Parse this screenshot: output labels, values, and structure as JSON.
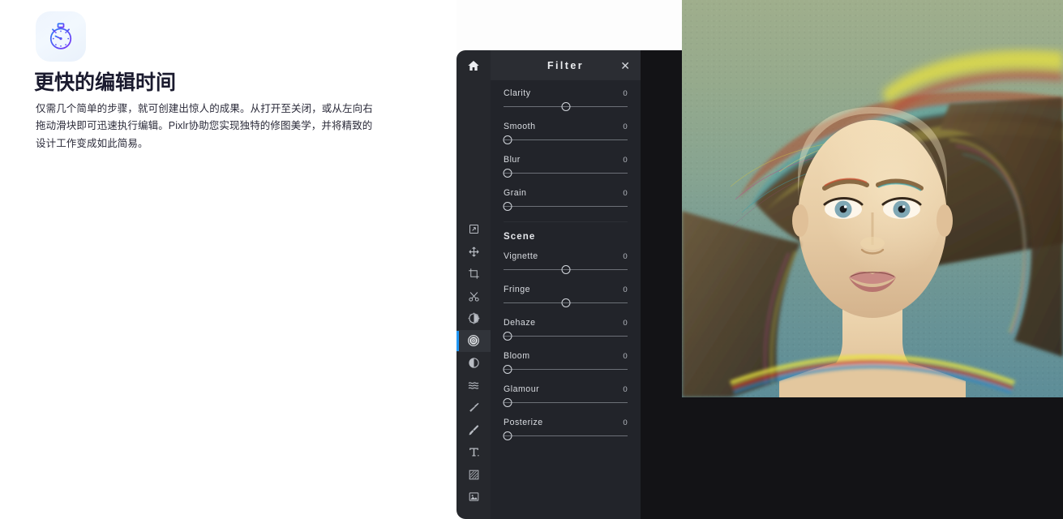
{
  "promo": {
    "icon_name": "stopwatch-icon",
    "title": "更快的编辑时间",
    "body": "仅需几个简单的步骤，就可创建出惊人的成果。从打开至关闭，或从左向右拖动滑块即可迅速执行编辑。Pixlr协助您实现独特的修图美学，并将精致的设计工作变成如此简易。",
    "icon_gradient_from": "#2f7df6",
    "icon_gradient_to": "#7b2ff7"
  },
  "editor": {
    "home_icon": "home-icon",
    "panel": {
      "title": "Filter",
      "close_label": "✕",
      "accent": "#2196f3",
      "background": "#22242a",
      "header_background": "#2b2d33",
      "sections": [
        {
          "name": "",
          "controls": [
            {
              "label": "Clarity",
              "value": "0",
              "percent": 50
            },
            {
              "label": "Smooth",
              "value": "0",
              "percent": 0
            },
            {
              "label": "Blur",
              "value": "0",
              "percent": 0
            },
            {
              "label": "Grain",
              "value": "0",
              "percent": 0
            }
          ]
        },
        {
          "name": "Scene",
          "controls": [
            {
              "label": "Vignette",
              "value": "0",
              "percent": 50
            },
            {
              "label": "Fringe",
              "value": "0",
              "percent": 50
            },
            {
              "label": "Dehaze",
              "value": "0",
              "percent": 0
            },
            {
              "label": "Bloom",
              "value": "0",
              "percent": 0
            },
            {
              "label": "Glamour",
              "value": "0",
              "percent": 0
            },
            {
              "label": "Posterize",
              "value": "0",
              "percent": 0
            }
          ]
        }
      ]
    },
    "toolbar": {
      "active_index": 5,
      "tools": [
        {
          "name": "arrange-tool",
          "icon": "arrange-icon"
        },
        {
          "name": "move-tool",
          "icon": "move-icon"
        },
        {
          "name": "crop-tool",
          "icon": "crop-icon"
        },
        {
          "name": "cutout-tool",
          "icon": "scissors-icon"
        },
        {
          "name": "adjust-tool",
          "icon": "contrast-circle-icon"
        },
        {
          "name": "filter-tool",
          "icon": "filter-dots-icon"
        },
        {
          "name": "dodge-burn-tool",
          "icon": "half-fill-circle-icon"
        },
        {
          "name": "liquify-tool",
          "icon": "waves-icon"
        },
        {
          "name": "retouch-tool",
          "icon": "retouch-icon"
        },
        {
          "name": "paint-tool",
          "icon": "brush-icon"
        },
        {
          "name": "text-tool",
          "icon": "text-t-icon"
        },
        {
          "name": "pattern-tool",
          "icon": "pattern-icon"
        },
        {
          "name": "image-tool",
          "icon": "image-icon"
        }
      ]
    },
    "canvas": {
      "name": "photo-canvas",
      "alt": "portrait-with-chromatic-fringe-filter",
      "backdrop_color": "#131316",
      "bg_top": "#9fae8c",
      "bg_bottom": "#5d8d98"
    }
  }
}
